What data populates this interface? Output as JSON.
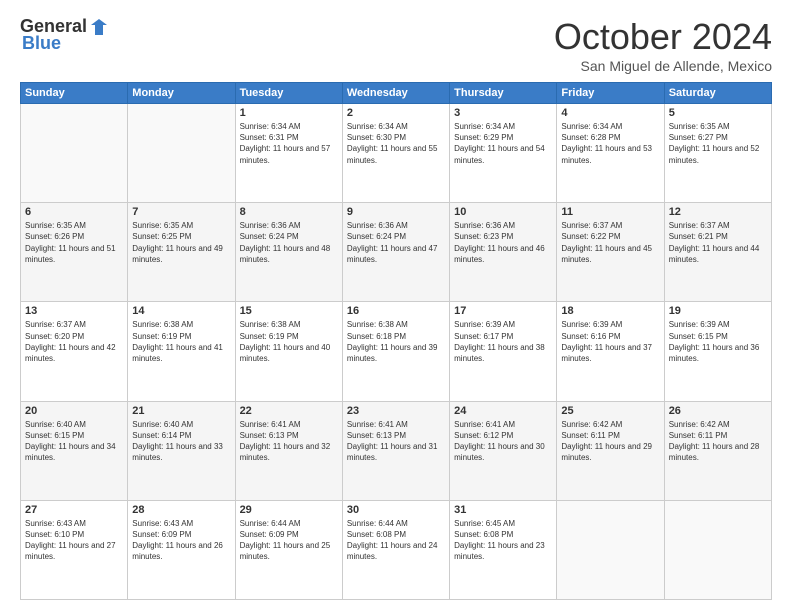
{
  "header": {
    "logo_general": "General",
    "logo_blue": "Blue",
    "title": "October 2024",
    "subtitle": "San Miguel de Allende, Mexico"
  },
  "calendar": {
    "days_of_week": [
      "Sunday",
      "Monday",
      "Tuesday",
      "Wednesday",
      "Thursday",
      "Friday",
      "Saturday"
    ],
    "weeks": [
      [
        {
          "day": "",
          "info": ""
        },
        {
          "day": "",
          "info": ""
        },
        {
          "day": "1",
          "info": "Sunrise: 6:34 AM\nSunset: 6:31 PM\nDaylight: 11 hours and 57 minutes."
        },
        {
          "day": "2",
          "info": "Sunrise: 6:34 AM\nSunset: 6:30 PM\nDaylight: 11 hours and 55 minutes."
        },
        {
          "day": "3",
          "info": "Sunrise: 6:34 AM\nSunset: 6:29 PM\nDaylight: 11 hours and 54 minutes."
        },
        {
          "day": "4",
          "info": "Sunrise: 6:34 AM\nSunset: 6:28 PM\nDaylight: 11 hours and 53 minutes."
        },
        {
          "day": "5",
          "info": "Sunrise: 6:35 AM\nSunset: 6:27 PM\nDaylight: 11 hours and 52 minutes."
        }
      ],
      [
        {
          "day": "6",
          "info": "Sunrise: 6:35 AM\nSunset: 6:26 PM\nDaylight: 11 hours and 51 minutes."
        },
        {
          "day": "7",
          "info": "Sunrise: 6:35 AM\nSunset: 6:25 PM\nDaylight: 11 hours and 49 minutes."
        },
        {
          "day": "8",
          "info": "Sunrise: 6:36 AM\nSunset: 6:24 PM\nDaylight: 11 hours and 48 minutes."
        },
        {
          "day": "9",
          "info": "Sunrise: 6:36 AM\nSunset: 6:24 PM\nDaylight: 11 hours and 47 minutes."
        },
        {
          "day": "10",
          "info": "Sunrise: 6:36 AM\nSunset: 6:23 PM\nDaylight: 11 hours and 46 minutes."
        },
        {
          "day": "11",
          "info": "Sunrise: 6:37 AM\nSunset: 6:22 PM\nDaylight: 11 hours and 45 minutes."
        },
        {
          "day": "12",
          "info": "Sunrise: 6:37 AM\nSunset: 6:21 PM\nDaylight: 11 hours and 44 minutes."
        }
      ],
      [
        {
          "day": "13",
          "info": "Sunrise: 6:37 AM\nSunset: 6:20 PM\nDaylight: 11 hours and 42 minutes."
        },
        {
          "day": "14",
          "info": "Sunrise: 6:38 AM\nSunset: 6:19 PM\nDaylight: 11 hours and 41 minutes."
        },
        {
          "day": "15",
          "info": "Sunrise: 6:38 AM\nSunset: 6:19 PM\nDaylight: 11 hours and 40 minutes."
        },
        {
          "day": "16",
          "info": "Sunrise: 6:38 AM\nSunset: 6:18 PM\nDaylight: 11 hours and 39 minutes."
        },
        {
          "day": "17",
          "info": "Sunrise: 6:39 AM\nSunset: 6:17 PM\nDaylight: 11 hours and 38 minutes."
        },
        {
          "day": "18",
          "info": "Sunrise: 6:39 AM\nSunset: 6:16 PM\nDaylight: 11 hours and 37 minutes."
        },
        {
          "day": "19",
          "info": "Sunrise: 6:39 AM\nSunset: 6:15 PM\nDaylight: 11 hours and 36 minutes."
        }
      ],
      [
        {
          "day": "20",
          "info": "Sunrise: 6:40 AM\nSunset: 6:15 PM\nDaylight: 11 hours and 34 minutes."
        },
        {
          "day": "21",
          "info": "Sunrise: 6:40 AM\nSunset: 6:14 PM\nDaylight: 11 hours and 33 minutes."
        },
        {
          "day": "22",
          "info": "Sunrise: 6:41 AM\nSunset: 6:13 PM\nDaylight: 11 hours and 32 minutes."
        },
        {
          "day": "23",
          "info": "Sunrise: 6:41 AM\nSunset: 6:13 PM\nDaylight: 11 hours and 31 minutes."
        },
        {
          "day": "24",
          "info": "Sunrise: 6:41 AM\nSunset: 6:12 PM\nDaylight: 11 hours and 30 minutes."
        },
        {
          "day": "25",
          "info": "Sunrise: 6:42 AM\nSunset: 6:11 PM\nDaylight: 11 hours and 29 minutes."
        },
        {
          "day": "26",
          "info": "Sunrise: 6:42 AM\nSunset: 6:11 PM\nDaylight: 11 hours and 28 minutes."
        }
      ],
      [
        {
          "day": "27",
          "info": "Sunrise: 6:43 AM\nSunset: 6:10 PM\nDaylight: 11 hours and 27 minutes."
        },
        {
          "day": "28",
          "info": "Sunrise: 6:43 AM\nSunset: 6:09 PM\nDaylight: 11 hours and 26 minutes."
        },
        {
          "day": "29",
          "info": "Sunrise: 6:44 AM\nSunset: 6:09 PM\nDaylight: 11 hours and 25 minutes."
        },
        {
          "day": "30",
          "info": "Sunrise: 6:44 AM\nSunset: 6:08 PM\nDaylight: 11 hours and 24 minutes."
        },
        {
          "day": "31",
          "info": "Sunrise: 6:45 AM\nSunset: 6:08 PM\nDaylight: 11 hours and 23 minutes."
        },
        {
          "day": "",
          "info": ""
        },
        {
          "day": "",
          "info": ""
        }
      ]
    ]
  }
}
